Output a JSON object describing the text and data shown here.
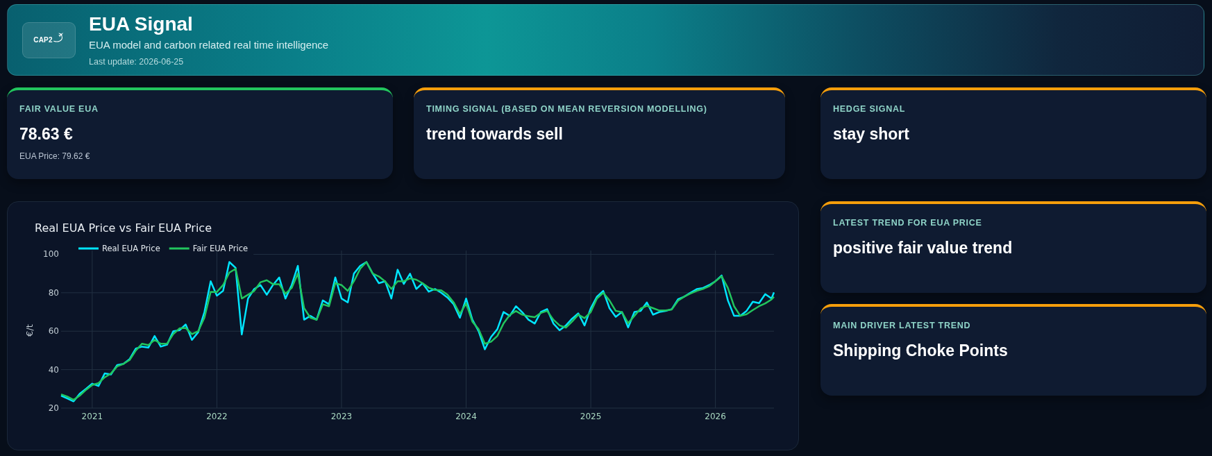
{
  "header": {
    "logo_text": "CAP2",
    "title": "EUA Signal",
    "subtitle": "EUA model and carbon related real time intelligence",
    "last_update": "Last update: 2026-06-25"
  },
  "signal_cards": [
    {
      "label": "FAIR VALUE EUA",
      "value": "78.63 €",
      "detail": "EUA Price: 79.62 €",
      "color": "#22c55e"
    },
    {
      "label": "TIMING SIGNAL (BASED ON MEAN REVERSION MODELLING)",
      "value": "trend towards sell",
      "color": "#f59e0b"
    },
    {
      "label": "HEDGE SIGNAL",
      "value": "stay short",
      "color": "#f59e0b"
    }
  ],
  "chart": {
    "chart_data": {
      "type": "line",
      "title": "Real EUA Price vs Fair EUA Price",
      "ylabel": "€/t",
      "x": [
        2020.75,
        2020.8,
        2020.85,
        2020.9,
        2020.95,
        2021,
        2021.05,
        2021.1,
        2021.15,
        2021.2,
        2021.25,
        2021.3,
        2021.35,
        2021.4,
        2021.45,
        2021.5,
        2021.55,
        2021.6,
        2021.65,
        2021.7,
        2021.75,
        2021.8,
        2021.85,
        2021.9,
        2021.95,
        2022,
        2022.05,
        2022.1,
        2022.15,
        2022.2,
        2022.25,
        2022.3,
        2022.35,
        2022.4,
        2022.45,
        2022.5,
        2022.55,
        2022.6,
        2022.65,
        2022.7,
        2022.75,
        2022.8,
        2022.85,
        2022.9,
        2022.95,
        2023,
        2023.05,
        2023.1,
        2023.15,
        2023.2,
        2023.25,
        2023.3,
        2023.35,
        2023.4,
        2023.45,
        2023.5,
        2023.55,
        2023.6,
        2023.65,
        2023.7,
        2023.75,
        2023.8,
        2023.85,
        2023.9,
        2023.95,
        2024,
        2024.05,
        2024.1,
        2024.15,
        2024.2,
        2024.25,
        2024.3,
        2024.35,
        2024.4,
        2024.45,
        2024.5,
        2024.55,
        2024.6,
        2024.65,
        2024.7,
        2024.75,
        2024.8,
        2024.85,
        2024.9,
        2024.95,
        2025,
        2025.05,
        2025.1,
        2025.15,
        2025.2,
        2025.25,
        2025.3,
        2025.35,
        2025.4,
        2025.45,
        2025.5,
        2025.55,
        2025.6,
        2025.65,
        2025.7,
        2025.75,
        2025.8,
        2025.85,
        2025.9,
        2025.95,
        2026,
        2026.05,
        2026.1,
        2026.15,
        2026.2,
        2026.25,
        2026.3,
        2026.35,
        2026.4,
        2026.45,
        2026.47
      ],
      "series": [
        {
          "name": "Real EUA Price",
          "color": "#00e5ff",
          "values": [
            26.5,
            25,
            23.5,
            27.5,
            30,
            32.7,
            31.5,
            38,
            37.5,
            42.4,
            43,
            45.5,
            51,
            52,
            51.5,
            57.5,
            52,
            53,
            60,
            60.5,
            63.5,
            55.5,
            59.5,
            70,
            86,
            78.5,
            81,
            96,
            93,
            58.3,
            77,
            82,
            84,
            79,
            84,
            88,
            77,
            84,
            94,
            66,
            68,
            66,
            76,
            74,
            88,
            77,
            75,
            90,
            94,
            96,
            90,
            85,
            86,
            77,
            92,
            84.6,
            89.9,
            82,
            85,
            80.6,
            82,
            80,
            77.5,
            74,
            67,
            77,
            66,
            60,
            50.6,
            57,
            61,
            70,
            68,
            73,
            69.9,
            66,
            64,
            70,
            71.5,
            64,
            60.5,
            63,
            66.5,
            69.3,
            63,
            72,
            78,
            81,
            72,
            67.5,
            70,
            62,
            70,
            70.6,
            75,
            68.6,
            70,
            70.5,
            71.5,
            76.6,
            78,
            80,
            81.9,
            82.5,
            84,
            86,
            89,
            76,
            68,
            68,
            70.6,
            75.3,
            74.6,
            79.3,
            77,
            80.2
          ]
        },
        {
          "name": "Fair EUA Price",
          "color": "#22c55e",
          "values": [
            27.2,
            26,
            24.3,
            26.5,
            29.5,
            32,
            33,
            36,
            38,
            41.7,
            43,
            45,
            50,
            53.5,
            52.8,
            55.5,
            53.5,
            53.5,
            58.5,
            61.5,
            61.7,
            58.5,
            60,
            67,
            80.5,
            80.4,
            84,
            90.5,
            92.5,
            77,
            79,
            81,
            85.5,
            86.5,
            84.5,
            84.5,
            79.5,
            82.5,
            90,
            72,
            67,
            65.9,
            74,
            73,
            85,
            84,
            81,
            86,
            92.5,
            96,
            90,
            88.5,
            85.9,
            82,
            86,
            86,
            87.5,
            86.8,
            85,
            82.6,
            81.5,
            81.3,
            79,
            75,
            69,
            74.5,
            65,
            61,
            53.5,
            54.5,
            57.5,
            64,
            68.5,
            70.5,
            68.6,
            67.8,
            67.3,
            69.5,
            70.6,
            66,
            63,
            61.9,
            65,
            68.6,
            66.8,
            70,
            77,
            80,
            76,
            70.6,
            69.9,
            64.2,
            68,
            71.8,
            73.2,
            72,
            70.8,
            70.8,
            71.3,
            75.9,
            78,
            79.6,
            81,
            82,
            83.4,
            86,
            88.6,
            82.5,
            73,
            68,
            68.8,
            71,
            73,
            74.5,
            76.5,
            77.9
          ]
        }
      ],
      "xlim": [
        2020.75,
        2026.47
      ],
      "ylim": [
        20,
        101.6
      ],
      "xticks": [
        2021,
        2022,
        2023,
        2024,
        2025,
        2026
      ],
      "yticks": [
        20,
        40,
        60,
        80,
        100
      ],
      "grid": true,
      "legend": true
    }
  },
  "trend_cards": [
    {
      "label": "LATEST TREND FOR EUA PRICE",
      "value": "positive fair value trend",
      "color": "#f59e0b"
    },
    {
      "label": "MAIN DRIVER LATEST TREND",
      "value": "Shipping Choke Points",
      "color": "#f59e0b"
    }
  ]
}
